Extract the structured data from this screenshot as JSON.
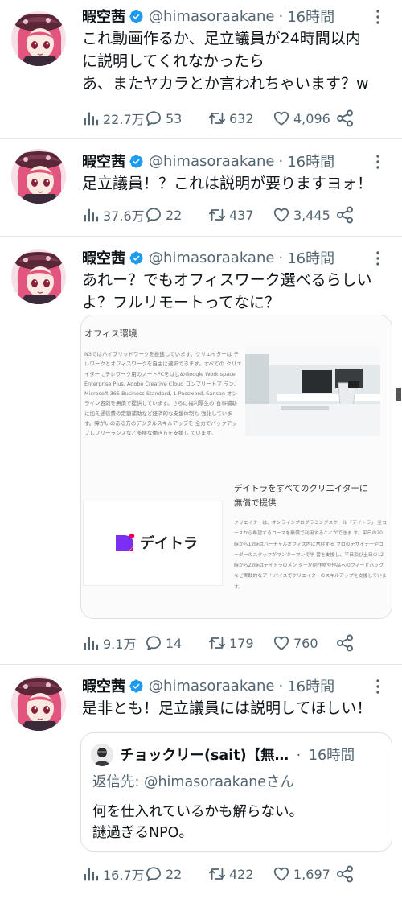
{
  "colors": {
    "text": "#0f1419",
    "muted": "#536471",
    "verified": "#1d9bf0",
    "accent": "#e0006c"
  },
  "tweets": [
    {
      "name": "暇空茜",
      "handle": "@himasoraakane",
      "dot": "·",
      "time": "16時間",
      "text": "これ動画作るか、足立議員が24時間以内\nに説明してくれなかったら\nあ、またヤカラとか言われちゃいます？w",
      "views": "22.7万",
      "replies": "53",
      "retweets": "632",
      "likes": "4,096"
    },
    {
      "name": "暇空茜",
      "handle": "@himasoraakane",
      "dot": "·",
      "time": "16時間",
      "text": "足立議員！？これは説明が要りますヨォ！",
      "views": "37.6万",
      "replies": "22",
      "retweets": "437",
      "likes": "3,445"
    },
    {
      "name": "暇空茜",
      "handle": "@himasoraakane",
      "dot": "·",
      "time": "16時間",
      "text": "あれー？でもオフィスワーク選べるらしい\nよ？フルリモートってなに？",
      "views": "9.1万",
      "replies": "14",
      "retweets": "179",
      "likes": "760",
      "media": {
        "heading": "オフィス環境",
        "paragraph": "N3ではハイブリッドワークを推進しています。クリエイターは テレワークとオフィスワークを自由に選択できます。すべての クリエイターにテレワーク用のノートPCをはじめGoogle Work space Enterprise Plus, Adobe Creative Cloud コンプリートプ ラン, Microsoft 365 Business Standard, 1 Password, Sansan オンライン名刺を無償で提供しています。さらに福利厚生の 食事補助に加え通信費の定額補助など経済的な支援体制も 強化しています。障がいのある方のデジタルスキルアップを 全力でバックアップしフリーランスなど多様な働き方を支援し ています。",
        "logo_text": "デイトラ",
        "subheading": "デイトラをすべてのクリエイターに\n無償で提供",
        "subparagraph": "クリエイターは、オンラインプログラミングスクール「デイトラ」 全コースから希望するコースを無償で利用することができま す。平日の20時から12時はバーチャルオフィス内に常駐する プロのデザイナーやコーダーのスタッフがマンツーマンで学 習を支援し、平日及び土日の12時から22時はデイトラのメン ターが制作物や作品へのフィードバックなど実践的なアド バイスでクリエイターのスキルアップを支援しています。"
      }
    },
    {
      "name": "暇空茜",
      "handle": "@himasoraakane",
      "dot": "·",
      "time": "16時間",
      "text": "是非とも！足立議員には説明してほしい！",
      "views": "16.7万",
      "replies": "22",
      "retweets": "422",
      "likes": "1,697",
      "quote": {
        "name": "チョックリー(sait)【無…",
        "dot": "·",
        "time": "16時間",
        "reply_to": "返信先: @himasoraakaneさん",
        "text": "何を仕入れているかも解らない。\n謎過ぎるNPO。"
      }
    }
  ]
}
